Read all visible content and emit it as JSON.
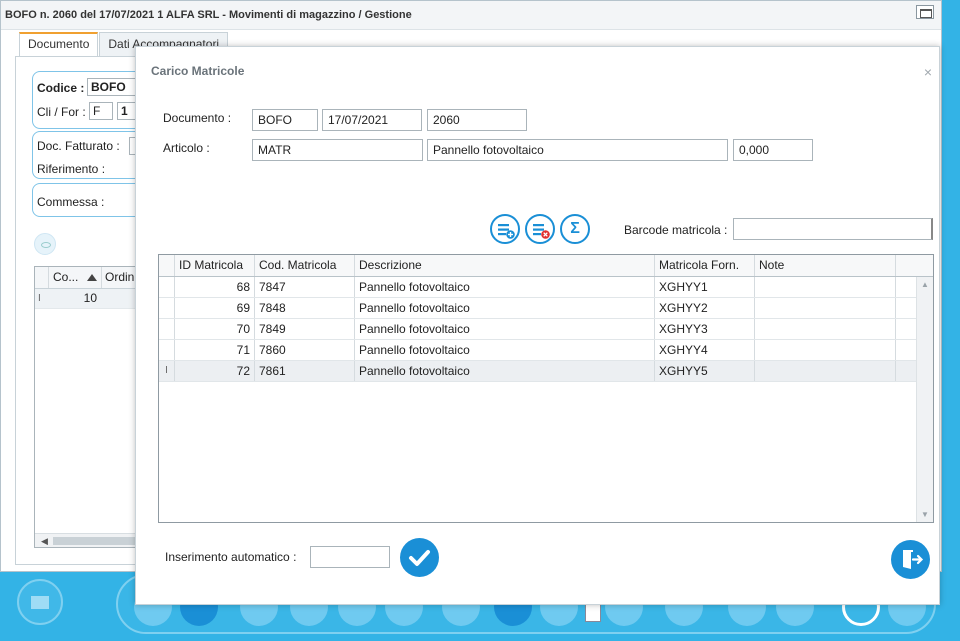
{
  "background_window": {
    "title": "BOFO n. 2060 del 17/07/2021 1 ALFA SRL - Movimenti di magazzino / Gestione",
    "tabs": [
      {
        "label": "Documento",
        "active": true
      },
      {
        "label": "Dati Accompagnatori",
        "active": false
      }
    ],
    "codice_label": "Codice :",
    "codice_value": "BOFO",
    "clifor_label": "Cli / For :",
    "clifor_type": "F",
    "clifor_code": "1",
    "doc_fatturato_label": "Doc. Fatturato :",
    "riferimento_label": "Riferimento :",
    "commessa_label": "Commessa :",
    "grid_columns": [
      "Co...",
      "Ordin..."
    ],
    "grid_row": {
      "indicator": "I",
      "value": "10"
    }
  },
  "dialog": {
    "title": "Carico Matricole",
    "close_glyph": "×",
    "documento_label": "Documento :",
    "documento_tipo": "BOFO",
    "documento_data": "17/07/2021",
    "documento_numero": "2060",
    "articolo_label": "Articolo :",
    "articolo_codice": "MATR",
    "articolo_descrizione": "Pannello fotovoltaico",
    "articolo_quantita": "0,000",
    "sigma_glyph": "Σ",
    "barcode_label": "Barcode matricola :",
    "barcode_value": "",
    "grid": {
      "columns": [
        "ID Matricola",
        "Cod. Matricola",
        "Descrizione",
        "Matricola Forn.",
        "Note"
      ],
      "rows": [
        {
          "id": "68",
          "cod": "7847",
          "descrizione": "Pannello fotovoltaico",
          "forn": "XGHYY1",
          "note": "",
          "indicator": ""
        },
        {
          "id": "69",
          "cod": "7848",
          "descrizione": "Pannello fotovoltaico",
          "forn": "XGHYY2",
          "note": "",
          "indicator": ""
        },
        {
          "id": "70",
          "cod": "7849",
          "descrizione": "Pannello fotovoltaico",
          "forn": "XGHYY3",
          "note": "",
          "indicator": ""
        },
        {
          "id": "71",
          "cod": "7860",
          "descrizione": "Pannello fotovoltaico",
          "forn": "XGHYY4",
          "note": "",
          "indicator": ""
        },
        {
          "id": "72",
          "cod": "7861",
          "descrizione": "Pannello fotovoltaico",
          "forn": "XGHYY5",
          "note": "",
          "indicator": "I"
        }
      ]
    },
    "inserimento_label": "Inserimento automatico :",
    "inserimento_value": ""
  },
  "colors": {
    "accent": "#1a8fd6",
    "desktop": "#33b3e6",
    "tab_active_border": "#f0a030"
  }
}
